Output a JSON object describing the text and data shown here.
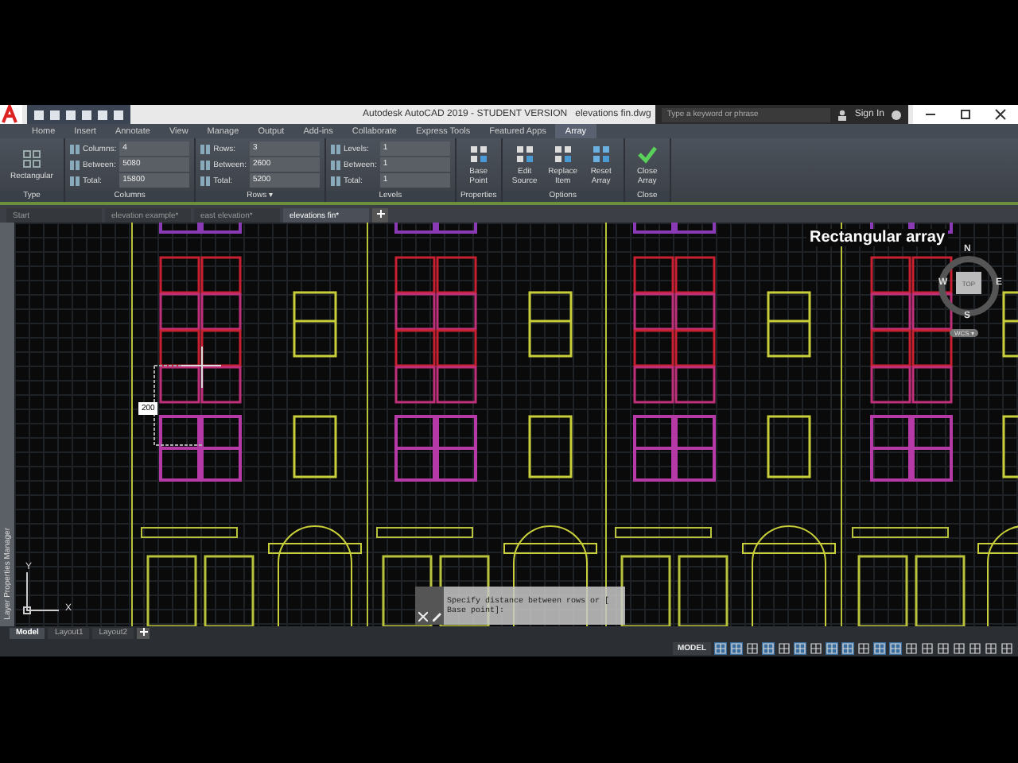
{
  "title_bar": {
    "app_title": "Autodesk AutoCAD 2019 - STUDENT VERSION",
    "file_name": "elevations fin.dwg",
    "search": {
      "placeholder": "Type a keyword or phrase"
    },
    "sign_in": "Sign In"
  },
  "ribbon_tabs": [
    {
      "label": "Home",
      "selected": false
    },
    {
      "label": "Insert",
      "selected": false
    },
    {
      "label": "Annotate",
      "selected": false
    },
    {
      "label": "View",
      "selected": false
    },
    {
      "label": "Manage",
      "selected": false
    },
    {
      "label": "Output",
      "selected": false
    },
    {
      "label": "Add-ins",
      "selected": false
    },
    {
      "label": "Collaborate",
      "selected": false
    },
    {
      "label": "Express Tools",
      "selected": false
    },
    {
      "label": "Featured Apps",
      "selected": false
    },
    {
      "label": "Array",
      "selected": true
    }
  ],
  "ribbon_panels": [
    {
      "kind": "buttons",
      "title": "Type",
      "buttons": [
        "Rectangular"
      ]
    },
    {
      "kind": "fields",
      "title": "Columns",
      "fields": [
        {
          "label": "Columns:",
          "value": "4"
        },
        {
          "label": "Between:",
          "value": "5080"
        },
        {
          "label": "Total:",
          "value": "15800"
        }
      ]
    },
    {
      "kind": "fields",
      "title": "Rows ▾",
      "fields": [
        {
          "label": "Rows:",
          "value": "3"
        },
        {
          "label": "Between:",
          "value": "2600"
        },
        {
          "label": "Total:",
          "value": "5200"
        }
      ]
    },
    {
      "kind": "fields",
      "title": "Levels",
      "fields": [
        {
          "label": "Levels:",
          "value": "1"
        },
        {
          "label": "Between:",
          "value": "1"
        },
        {
          "label": "Total:",
          "value": "1"
        }
      ]
    },
    {
      "kind": "buttons",
      "title": "Properties",
      "buttons": [
        "Base Point"
      ]
    },
    {
      "kind": "buttons",
      "title": "Options",
      "buttons": [
        "Edit Source",
        "Replace Item",
        "Reset Array"
      ]
    },
    {
      "kind": "buttons",
      "title": "Close",
      "buttons": [
        "Close Array"
      ]
    }
  ],
  "doc_tabs": [
    {
      "label": "Start",
      "selected": false
    },
    {
      "label": "elevation example*",
      "selected": false
    },
    {
      "label": "east elevation*",
      "selected": false
    },
    {
      "label": "elevations fin*",
      "selected": true
    }
  ],
  "canvas": {
    "palette_label": "Layer Properties Manager",
    "overlay_title": "Rectangular array",
    "dimension_tooltip": "200",
    "viewcube": {
      "north": "N",
      "west": "W",
      "top": "TOP",
      "east": "E",
      "south": "S",
      "wcs": "WCS ▾"
    },
    "ucs": {
      "y": "Y",
      "x": "X"
    },
    "command_lines": [
      "Specify distance between rows or [",
      "Base point]:"
    ]
  },
  "layout_tabs": [
    {
      "label": "Model",
      "selected": true
    },
    {
      "label": "Layout1",
      "selected": false
    },
    {
      "label": "Layout2",
      "selected": false
    }
  ],
  "status_bar": {
    "mode": "MODEL"
  }
}
